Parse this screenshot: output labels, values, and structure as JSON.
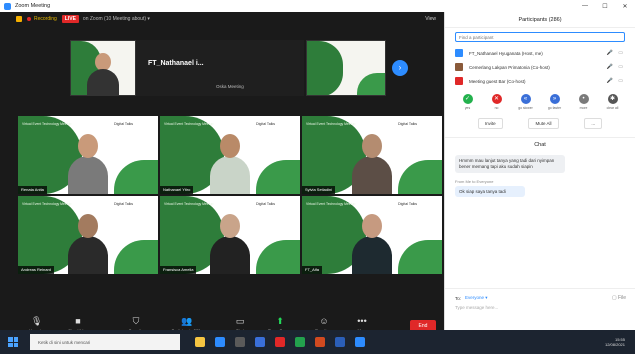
{
  "window": {
    "title": "Zoom Meeting",
    "controls": [
      "—",
      "☐",
      "✕"
    ]
  },
  "topbar": {
    "recording": "Recording",
    "live": "LIVE",
    "stream_info": "on Zoom (10 Meeting about) ▾",
    "view": "View"
  },
  "strip": {
    "speaker_name": "FT_Nathanael i...",
    "sub_label": "Oska Meeting"
  },
  "tiles": [
    {
      "name": "Renata Anita",
      "skin": "#c99a7a",
      "shirt": "#7a7a7a"
    },
    {
      "name": "Nathanael Yitro",
      "skin": "#b98a68",
      "shirt": "#c9d4c8"
    },
    {
      "name": "Sylvia Setiadini",
      "skin": "#b48c70",
      "shirt": "#5c4e46"
    },
    {
      "name": "Andreas Reinard",
      "skin": "#a37b5f",
      "shirt": "#2a2a2a"
    },
    {
      "name": "Fransisca Amelia",
      "skin": "#c9a48a",
      "shirt": "#222222"
    },
    {
      "name": "FT_Alfa",
      "skin": "#c69a80",
      "shirt": "#1e2a30"
    }
  ],
  "tile_background": {
    "headline": "Virtual Event Technology Meetup",
    "logo": "Digital Talks"
  },
  "toolbar": {
    "mute": "Unmute",
    "video": "Stop Video",
    "security": "Security",
    "participants": "Participants",
    "participants_count": "286",
    "chat": "Chat",
    "share": "Share Screen",
    "reactions": "Reactions",
    "more": "More",
    "end": "End"
  },
  "panel": {
    "title": "Participants (286)",
    "search_placeholder": "Find a participant",
    "participants": [
      {
        "name": "FT_Nathanael Hyuganata (Host, me)",
        "color": "#2d8cff",
        "icons": "🎤 ▭"
      },
      {
        "name": "Cemerlang Lakpan Primatonia (Co-host)",
        "color": "#8a5a3a",
        "icons": "🎤 ▭"
      },
      {
        "name": "Meeting guest Bar (Co-host)",
        "color": "#e02828",
        "icons": "🎤 ▭"
      }
    ],
    "reactions": [
      {
        "label": "yes",
        "glyph": "✓",
        "color": "#23b14d"
      },
      {
        "label": "no",
        "glyph": "✕",
        "color": "#e02828"
      },
      {
        "label": "go slower",
        "glyph": "«",
        "color": "#3a6fd8"
      },
      {
        "label": "go faster",
        "glyph": "»",
        "color": "#3a6fd8"
      },
      {
        "label": "more",
        "glyph": "•",
        "color": "#7a7a7a"
      },
      {
        "label": "clear all",
        "glyph": "✱",
        "color": "#555555"
      }
    ],
    "invite": "Invite",
    "mute_all": "Mute All",
    "more": "...",
    "chat_title": "Chat",
    "message_1": "Hmmm mau lanjut tanya yang tadi dari nyimpan bener memang tapi aku sudah siapin",
    "from_label": "From Me to Everyone",
    "message_2": "Ok siap saya tanya tadi",
    "to_label": "To:",
    "to_value": "Everyone ▾",
    "file": "File",
    "type_here": "Type message here..."
  },
  "taskbar": {
    "search_placeholder": "Ketik di sini untuk mencari",
    "time": "15:55",
    "date": "12/08/2021"
  }
}
